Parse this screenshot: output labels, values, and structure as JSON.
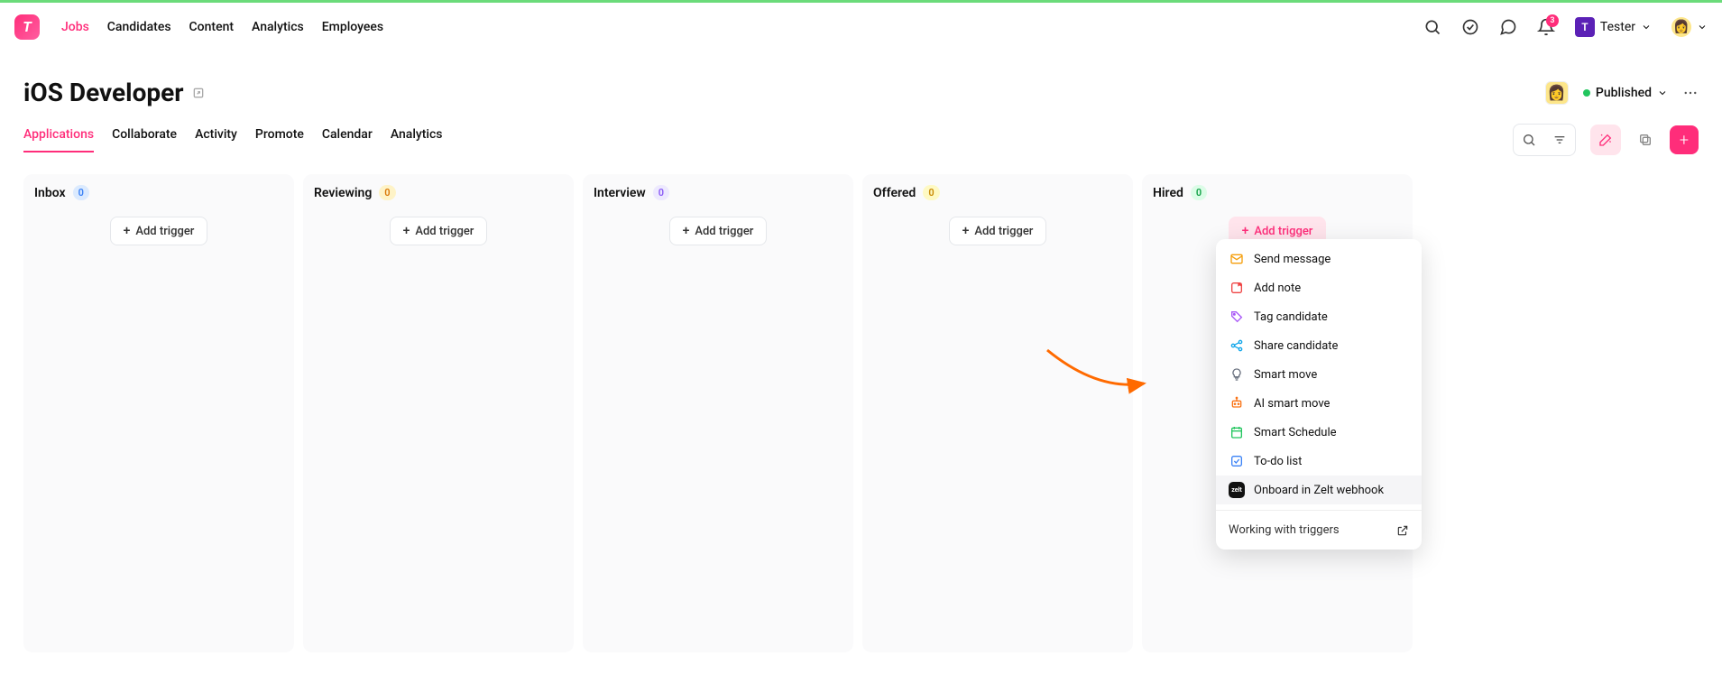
{
  "nav": {
    "items": [
      "Jobs",
      "Candidates",
      "Content",
      "Analytics",
      "Employees"
    ],
    "active": "Jobs"
  },
  "header": {
    "notification_count": "3",
    "account_initial": "T",
    "account_name": "Tester"
  },
  "page": {
    "title": "iOS Developer",
    "status": "Published"
  },
  "tabs": {
    "items": [
      "Applications",
      "Collaborate",
      "Activity",
      "Promote",
      "Calendar",
      "Analytics"
    ],
    "active": "Applications"
  },
  "columns": [
    {
      "name": "Inbox",
      "count": "0",
      "pill": "pill-blue",
      "trigger_label": "Add trigger",
      "active": false
    },
    {
      "name": "Reviewing",
      "count": "0",
      "pill": "pill-amber",
      "trigger_label": "Add trigger",
      "active": false
    },
    {
      "name": "Interview",
      "count": "0",
      "pill": "pill-violet",
      "trigger_label": "Add trigger",
      "active": false
    },
    {
      "name": "Offered",
      "count": "0",
      "pill": "pill-yellow",
      "trigger_label": "Add trigger",
      "active": false
    },
    {
      "name": "Hired",
      "count": "0",
      "pill": "pill-green",
      "trigger_label": "Add trigger",
      "active": true
    }
  ],
  "dropdown": {
    "items": [
      {
        "label": "Send message",
        "icon": "mail",
        "color": "#f59e0b"
      },
      {
        "label": "Add note",
        "icon": "note",
        "color": "#ef4444"
      },
      {
        "label": "Tag candidate",
        "icon": "tag",
        "color": "#a855f7"
      },
      {
        "label": "Share candidate",
        "icon": "share",
        "color": "#0ea5e9"
      },
      {
        "label": "Smart move",
        "icon": "bulb",
        "color": "#6b7280"
      },
      {
        "label": "AI smart move",
        "icon": "robot",
        "color": "#f97316"
      },
      {
        "label": "Smart Schedule",
        "icon": "calendar",
        "color": "#22c55e"
      },
      {
        "label": "To-do list",
        "icon": "check",
        "color": "#3b82f6"
      },
      {
        "label": "Onboard in Zelt webhook",
        "icon": "zelt",
        "color": "#111"
      }
    ],
    "hovered": "Onboard in Zelt webhook",
    "footer": "Working with triggers"
  }
}
